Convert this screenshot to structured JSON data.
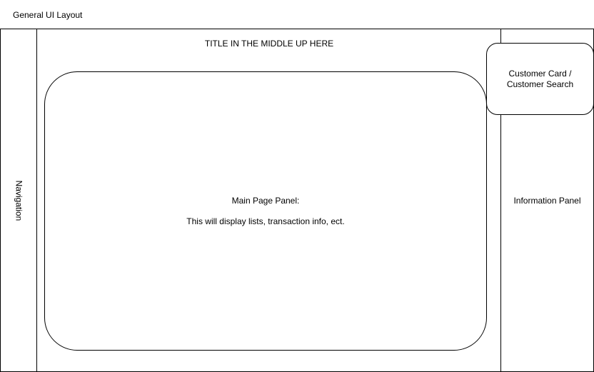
{
  "document": {
    "title": "General UI Layout"
  },
  "navigation": {
    "label": "Navigation"
  },
  "header": {
    "title": "TITLE IN THE MIDDLE UP HERE"
  },
  "main_panel": {
    "heading": "Main Page Panel:",
    "description": "This will display lists, transaction info, ect."
  },
  "customer_card": {
    "line1": "Customer Card /",
    "line2": "Customer Search"
  },
  "info_panel": {
    "label": "Information Panel"
  },
  "colors": {
    "stroke": "#000000",
    "background": "#ffffff"
  }
}
